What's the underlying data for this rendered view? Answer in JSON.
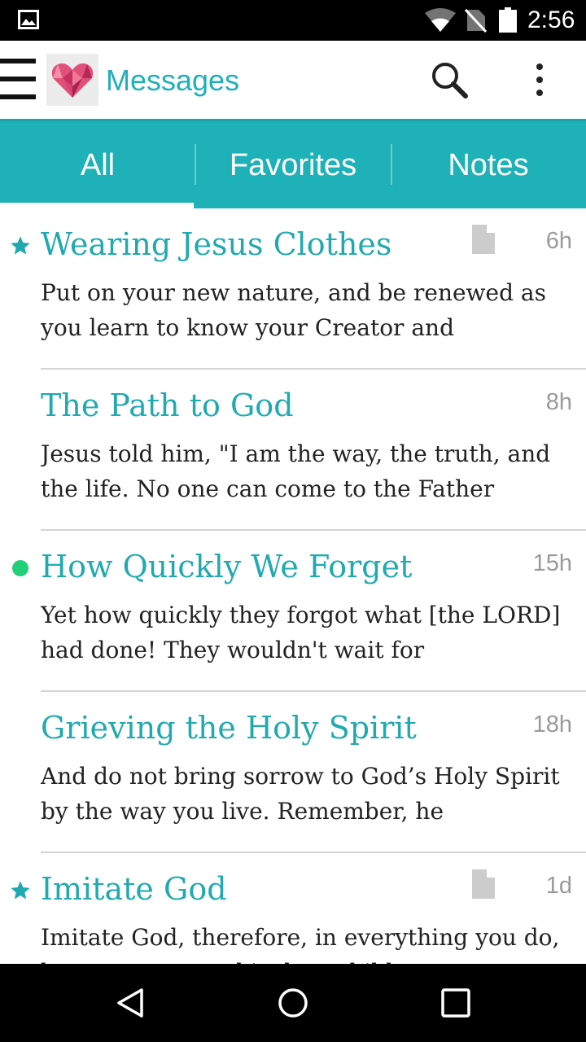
{
  "status_bar": {
    "time": "2:56",
    "icons": [
      "image-icon",
      "wifi-icon",
      "no-sim-icon",
      "battery-icon"
    ]
  },
  "app_bar": {
    "title": "Messages",
    "icons": [
      "menu-icon",
      "app-logo-heart",
      "search-icon",
      "more-vert-icon"
    ]
  },
  "tabs": [
    {
      "label": "All",
      "selected": true
    },
    {
      "label": "Favorites",
      "selected": false
    },
    {
      "label": "Notes",
      "selected": false
    }
  ],
  "messages": [
    {
      "title": "Wearing Jesus Clothes",
      "preview": "Put on your new nature, and be renewed as you learn to know your Creator and",
      "time": "6h",
      "favorite": true,
      "has_note": true,
      "unread": false
    },
    {
      "title": "The Path to God",
      "preview": "Jesus told him, \"I am the way, the truth, and the life. No one can come to the Father",
      "time": "8h",
      "favorite": false,
      "has_note": false,
      "unread": false
    },
    {
      "title": "How Quickly We Forget",
      "preview": "Yet how quickly they forgot what [the LORD] had done! They wouldn't wait for",
      "time": "15h",
      "favorite": false,
      "has_note": false,
      "unread": true
    },
    {
      "title": "Grieving the Holy Spirit",
      "preview": "And do not bring sorrow to God’s Holy Spirit by the way you live. Remember, he",
      "time": "18h",
      "favorite": false,
      "has_note": false,
      "unread": false
    },
    {
      "title": "Imitate God",
      "preview": "Imitate God, therefore, in everything you do, because you are his dear children.",
      "time": "1d",
      "favorite": true,
      "has_note": true,
      "unread": false
    }
  ],
  "colors": {
    "accent": "#1fb1b8",
    "title_text": "#20aab0",
    "unread_dot": "#22d07a",
    "status_bar": "#000000"
  }
}
